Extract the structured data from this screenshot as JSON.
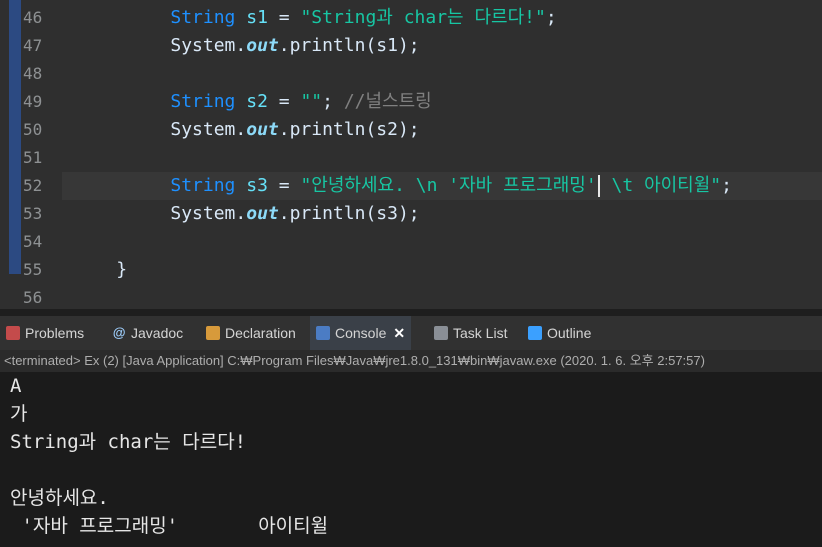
{
  "editor": {
    "line_numbers": [
      "46",
      "47",
      "48",
      "49",
      "50",
      "51",
      "52",
      "53",
      "54",
      "55",
      "56"
    ],
    "lines": {
      "l46": {
        "kw": "String",
        "var": "s1",
        "eq": " = ",
        "str": "\"String과 char는 다르다!\"",
        "end": ";"
      },
      "l47": {
        "pre": "System.",
        "out": "out",
        "post": ".println(s1);"
      },
      "l49": {
        "kw": "String",
        "var": "s2",
        "eq": " = ",
        "str": "\"\"",
        "end": "; ",
        "cmt": "//널스트링"
      },
      "l50": {
        "pre": "System.",
        "out": "out",
        "post": ".println(s2);"
      },
      "l52": {
        "kw": "String",
        "var": "s3",
        "eq": " = ",
        "str_a": "\"안녕하세요. \\n '자바 프로그래밍'",
        "str_b": " \\t 아이티윌\"",
        "end": ";"
      },
      "l53": {
        "pre": "System.",
        "out": "out",
        "post": ".println(s3);"
      },
      "l55": {
        "brace": "}"
      }
    }
  },
  "tabs": [
    {
      "label": "Problems",
      "icon": "problems-icon"
    },
    {
      "label": "Javadoc",
      "icon": "javadoc-icon",
      "glyph": "@"
    },
    {
      "label": "Declaration",
      "icon": "declaration-icon"
    },
    {
      "label": "Console",
      "icon": "console-icon",
      "close": "✕"
    },
    {
      "label": "Task List",
      "icon": "task-list-icon"
    },
    {
      "label": "Outline",
      "icon": "outline-icon"
    }
  ],
  "console_status": "<terminated> Ex (2) [Java Application] C:₩Program Files₩Java₩jre1.8.0_131₩bin₩javaw.exe (2020. 1. 6. 오후 2:57:57)",
  "console_output": [
    "A",
    "가",
    "String과 char는 다르다!",
    "",
    "안녕하세요.",
    " '자바 프로그래밍'       아이티윌"
  ],
  "colors": {
    "keyword": "#1e90ff",
    "variable": "#66e1f8",
    "string": "#17c6a3",
    "comment": "#808080",
    "background": "#2f2f2f",
    "console_bg": "#1b1b1b"
  }
}
